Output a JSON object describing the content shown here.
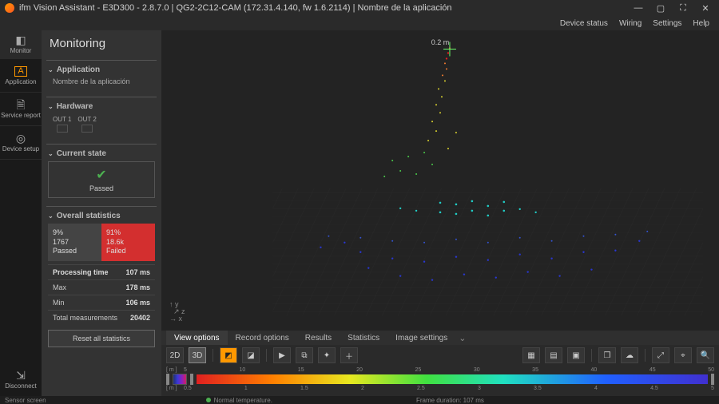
{
  "title": "ifm Vision Assistant - E3D300 - 2.8.7.0 | QG2-2C12-CAM (172.31.4.140, fw 1.6.2114) | Nombre de la aplicación",
  "menubar": [
    "Device status",
    "Wiring",
    "Settings",
    "Help"
  ],
  "nav": [
    {
      "label": "Monitor",
      "icon": "◧"
    },
    {
      "label": "Application",
      "icon": "A"
    },
    {
      "label": "Service report",
      "icon": "🗎"
    },
    {
      "label": "Device setup",
      "icon": "◎"
    }
  ],
  "nav_disconnect": {
    "label": "Disconnect",
    "icon": "⇲"
  },
  "sidebar": {
    "title": "Monitoring",
    "app": {
      "header": "Application",
      "name": "Nombre de la aplicación"
    },
    "hw": {
      "header": "Hardware",
      "out1": "OUT 1",
      "out2": "OUT 2"
    },
    "state": {
      "header": "Current state",
      "status": "Passed"
    },
    "stats": {
      "header": "Overall statistics",
      "passed": {
        "percent": "9%",
        "count": "1767",
        "label": "Passed"
      },
      "failed": {
        "percent": "91%",
        "count": "18.6k",
        "label": "Failed"
      },
      "table": [
        {
          "label": "Processing time",
          "value": "107 ms"
        },
        {
          "label": "Max",
          "value": "178 ms"
        },
        {
          "label": "Min",
          "value": "106 ms"
        },
        {
          "label": "Total measurements",
          "value": "20402"
        }
      ],
      "reset": "Reset all statistics"
    }
  },
  "viewport": {
    "distance_label": "0.2 m",
    "axes": [
      "y",
      "z",
      "x"
    ]
  },
  "tabs": [
    "View options",
    "Record options",
    "Results",
    "Statistics",
    "Image settings"
  ],
  "toolbar": {
    "mode2d": "2D",
    "mode3d": "3D"
  },
  "colorbar": {
    "top_unit": "[ m ]",
    "top_ticks": [
      "5",
      "10",
      "15",
      "20",
      "25",
      "30",
      "35",
      "40",
      "45",
      "50"
    ],
    "bot_unit": "[ m ]",
    "bot_ticks": [
      "0.5",
      "1",
      "1.5",
      "2",
      "2.5",
      "3",
      "3.5",
      "4",
      "4.5",
      "5"
    ]
  },
  "statusbar": {
    "sensor": "Sensor screen",
    "temp": "Normal temperature.",
    "frame": "Frame duration: 107 ms"
  }
}
